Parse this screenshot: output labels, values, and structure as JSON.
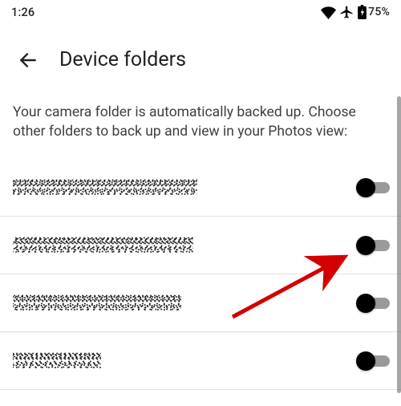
{
  "status_bar": {
    "time": "1:26",
    "battery_pct": "75%"
  },
  "header": {
    "title": "Device folders"
  },
  "description": "Your camera folder is automatically backed up. Choose other folders to back up and view in your Photos view:",
  "folders": [
    {
      "label": "[redacted]",
      "enabled": false
    },
    {
      "label": "[redacted]",
      "enabled": false
    },
    {
      "label": "[redacted]",
      "enabled": false
    },
    {
      "label": "[redacted]",
      "enabled": false
    }
  ],
  "annotation": {
    "target": "folder-toggle-2"
  }
}
